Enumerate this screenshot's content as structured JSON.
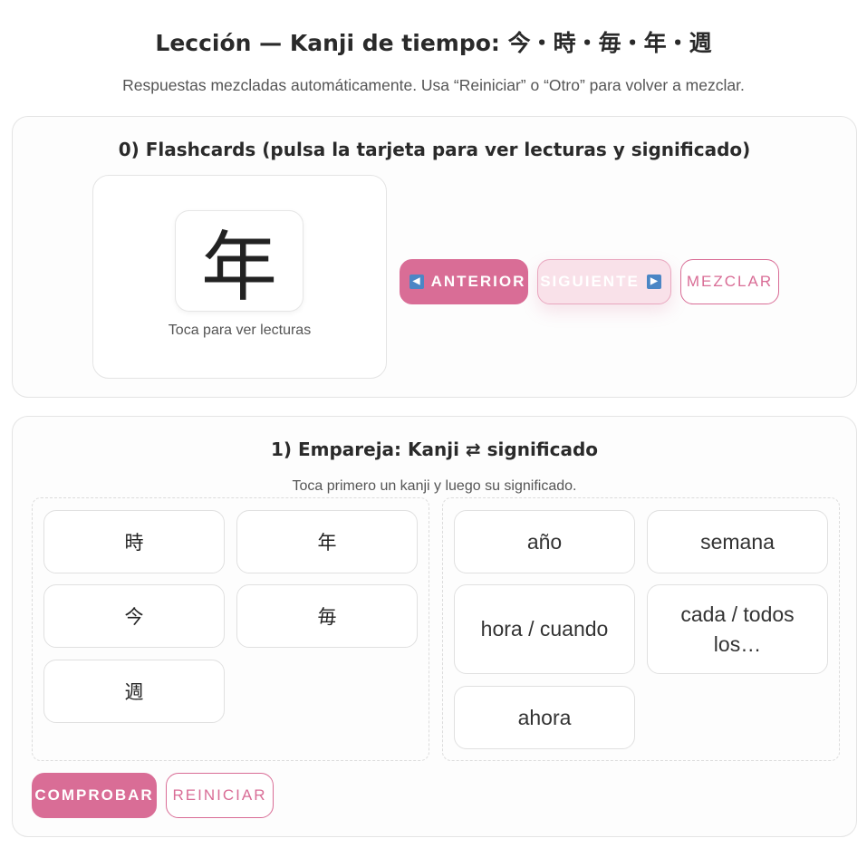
{
  "header": {
    "title": "Lección — Kanji de tiempo: 今・時・毎・年・週",
    "subtitle": "Respuestas mezcladas automáticamente. Usa “Reiniciar” o “Otro” para volver a mezclar."
  },
  "flashcards": {
    "section_title": "0) Flashcards (pulsa la tarjeta para ver lecturas y significado)",
    "current_kanji": "年",
    "hint": "Toca para ver lecturas",
    "prev_label": "ANTERIOR",
    "next_label": "SIGUIENTE",
    "shuffle_label": "MEZCLAR"
  },
  "match": {
    "section_title": "1) Empareja: Kanji ⇄ significado",
    "instruction": "Toca primero un kanji y luego su significado.",
    "kanji": [
      "時",
      "年",
      "今",
      "毎",
      "週"
    ],
    "meanings": [
      "año",
      "semana",
      "hora / cuando",
      "cada / todos los…",
      "ahora"
    ],
    "check_label": "COMPROBAR",
    "reset_label": "REINICIAR"
  },
  "colors": {
    "accent": "#d96d96",
    "arrow_icon": "#4b86c5"
  }
}
